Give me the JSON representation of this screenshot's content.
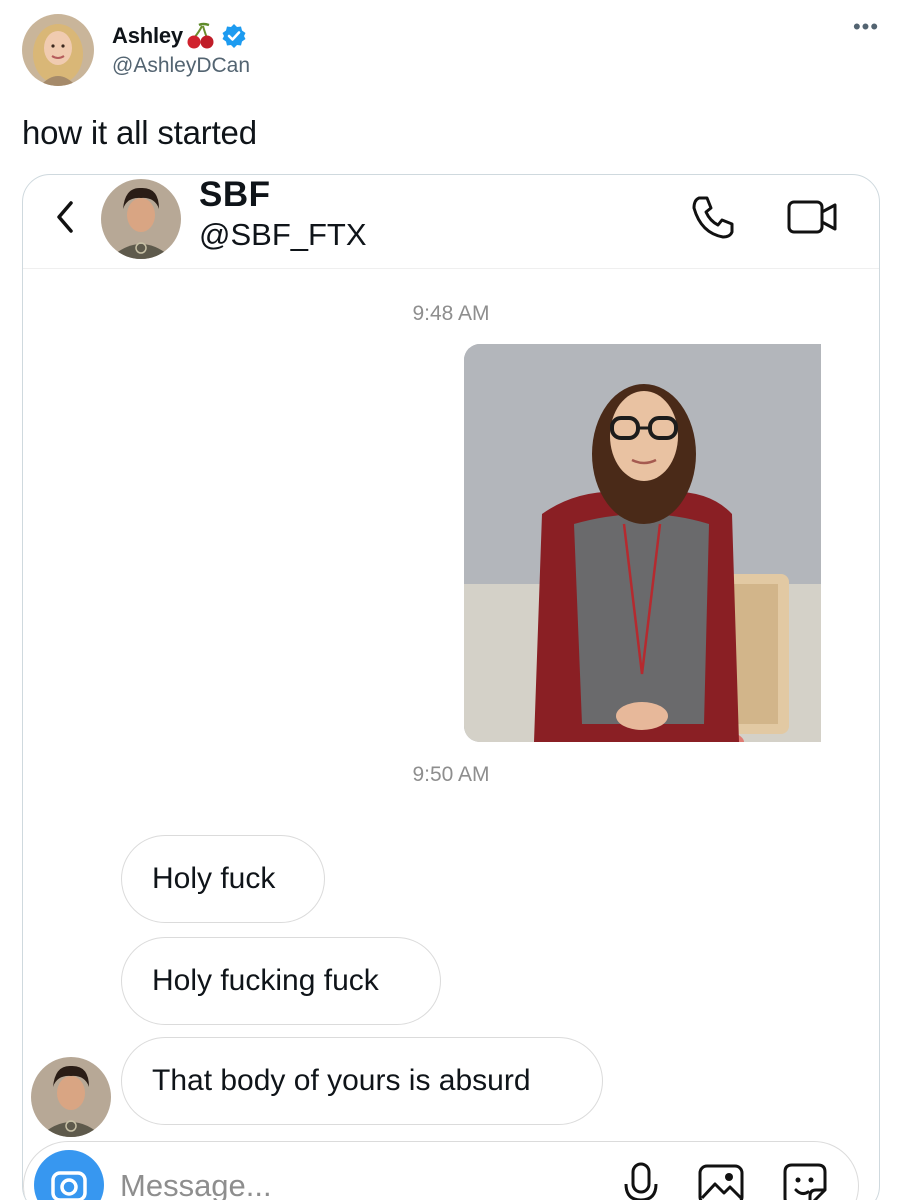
{
  "tweet": {
    "author_name": "Ashley",
    "author_handle": "@AshleyDCan",
    "name_emoji": "cherries",
    "verified": true,
    "more_icon": "ellipsis-icon",
    "text": "how it all started"
  },
  "dm": {
    "contact_name": "SBF",
    "contact_handle": "@SBF_FTX",
    "icons": [
      "back-chevron-icon",
      "phone-icon",
      "video-camera-icon"
    ],
    "messages": [
      {
        "type": "timestamp",
        "text": "9:48 AM"
      },
      {
        "type": "photo",
        "description_icon": "sent-photo"
      },
      {
        "type": "timestamp",
        "text": "9:50 AM"
      },
      {
        "type": "received",
        "text": "Holy fuck"
      },
      {
        "type": "received",
        "text": "Holy fucking fuck"
      },
      {
        "type": "received",
        "text": "That body of yours is absurd"
      }
    ],
    "composer": {
      "placeholder": "Message...",
      "icons": [
        "camera-icon",
        "microphone-icon",
        "gallery-icon",
        "sticker-icon"
      ]
    }
  },
  "colors": {
    "accent_blue": "#3797f0",
    "verified_blue": "#1d9bf0",
    "secondary_text": "#536471",
    "timestamp_gray": "#8e8e8e",
    "border_gray": "#dbdbdb"
  }
}
